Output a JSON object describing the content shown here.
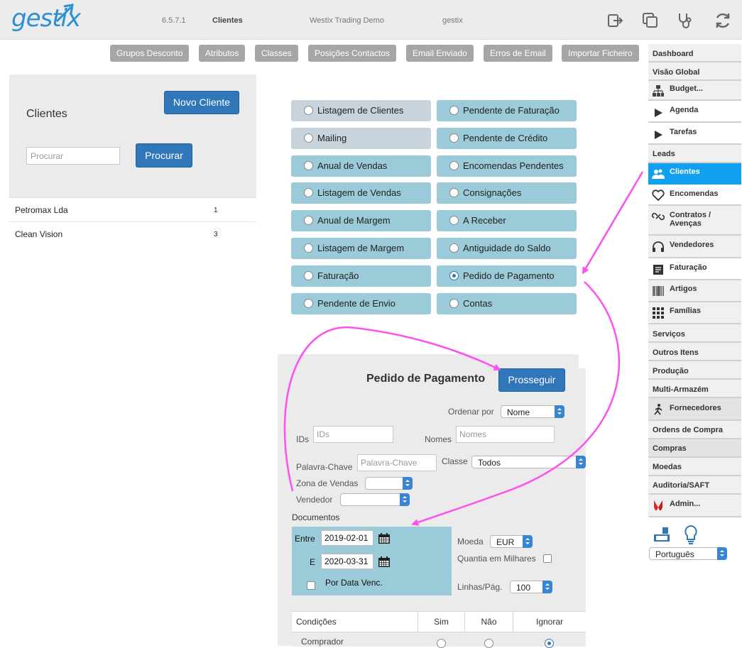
{
  "header": {
    "logo": "gestix",
    "version": "6.5.7.1",
    "section": "Clientes",
    "company": "Westix Trading Demo",
    "user": "gestix"
  },
  "top_buttons": [
    "Grupos Desconto",
    "Atributos",
    "Classes",
    "Posições Contactos",
    "Email Enviado",
    "Erros de Email",
    "Importar Ficheiro"
  ],
  "clients": {
    "title": "Clientes",
    "new_button": "Novo Cliente",
    "search_placeholder": "Procurar",
    "search_button": "Procurar",
    "rows": [
      {
        "name": "Petromax Lda",
        "count": "1"
      },
      {
        "name": "Clean Vision",
        "count": "3"
      }
    ]
  },
  "reports": {
    "left": [
      "Listagem de Clientes",
      "Mailing",
      "Anual de Vendas",
      "Listagem de Vendas",
      "Anual de Margem",
      "Listagem de Margem",
      "Faturação",
      "Pendente de Envio"
    ],
    "right": [
      "Pendente de Faturação",
      "Pendente de Crédito",
      "Encomendas Pendentes",
      "Consignações",
      "A Receber",
      "Antiguidade do Saldo",
      "Pedido de Pagamento",
      "Contas"
    ],
    "selected": "Pedido de Pagamento"
  },
  "form": {
    "title": "Pedido de Pagamento",
    "proceed": "Prosseguir",
    "order_label": "Ordenar por",
    "order_value": "Nome",
    "ids_label": "IDs",
    "ids_placeholder": "IDs",
    "names_label": "Nomes",
    "names_placeholder": "Nomes",
    "keyword_label": "Palavra-Chave",
    "keyword_placeholder": "Palavra-Chave",
    "class_label": "Classe",
    "class_value": "Todos",
    "zone_label": "Zona de Vendas",
    "seller_label": "Vendedor",
    "documents_label": "Documentos",
    "between_label": "Entre",
    "and_label": "E",
    "date_from": "2019-02-01",
    "date_to": "2020-03-31",
    "due_label": "Por Data Venc.",
    "currency_label": "Moeda",
    "currency_value": "EUR",
    "thousands_label": "Quantia em Milhares",
    "lines_label": "Linhas/Pág.",
    "lines_value": "100",
    "conditions": {
      "headers": [
        "Condições",
        "Sim",
        "Não",
        "Ignorar"
      ],
      "row1": "Comprador"
    }
  },
  "sidebar": {
    "items": [
      "Dashboard",
      "Visão Global",
      "Budget...",
      "Agenda",
      "Tarefas",
      "Leads",
      "Clientes",
      "Encomendas",
      "Contratos / Avenças",
      "Vendedores",
      "Faturação",
      "Artigos",
      "Famílias",
      "Serviços",
      "Outros Itens",
      "Produção",
      "Multi-Armazém",
      "Fornecedores",
      "Ordens de Compra",
      "Compras",
      "Moedas",
      "Auditoria/SAFT",
      "Admin..."
    ],
    "active": "Clientes",
    "language": "Português"
  },
  "colors": {
    "accent": "#2f77b8",
    "active_sidebar": "#0fa0ef",
    "option_blue": "#9bcad9",
    "option_gray": "#c8d3dc",
    "annotation": "#ff4ff0"
  }
}
